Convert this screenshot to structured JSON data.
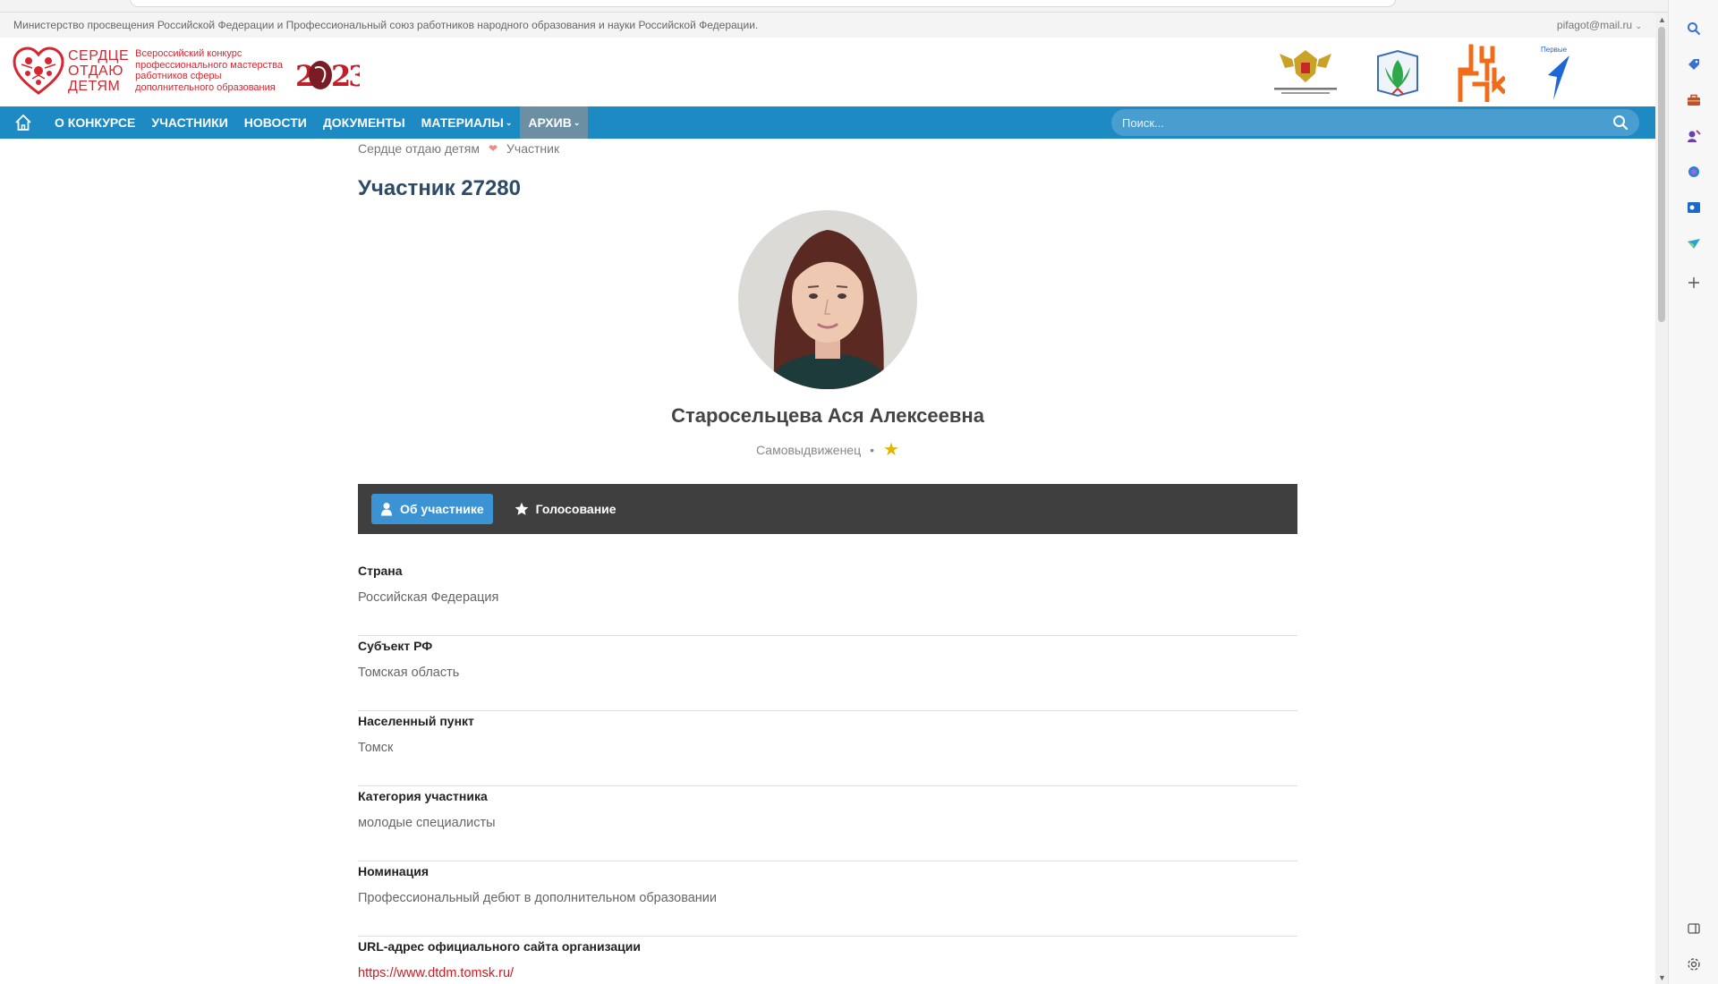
{
  "top_strip": {
    "ministry_text": "Министерство просвещения Российской Федерации и Профессиональный союз работников народного образования и науки Российской Федерации.",
    "user_email": "pifagot@mail.ru"
  },
  "header": {
    "logo_big_line1": "СЕРДЦЕ",
    "logo_big_line2": "ОТДАЮ",
    "logo_big_line3": "ДЕТЯМ",
    "logo_small_line1": "Всероссийский конкурс",
    "logo_small_line2": "профессионального мастерства",
    "logo_small_line3": "работников сферы",
    "logo_small_line4": "дополнительного образования",
    "year_logo": "2023",
    "partners": [
      "ministry-emblem",
      "profsoyuz-logo",
      "vtsk-logo",
      "pervye-logo"
    ],
    "pervye_label": "Первые"
  },
  "nav": {
    "items": [
      {
        "label": "О конкурсе"
      },
      {
        "label": "Участники"
      },
      {
        "label": "Новости"
      },
      {
        "label": "Документы"
      },
      {
        "label": "Материалы",
        "caret": "⌄"
      },
      {
        "label": "Архив",
        "caret": "⌄"
      }
    ],
    "search_placeholder": "Поиск..."
  },
  "breadcrumb": {
    "home": "Сердце отдаю детям",
    "current": "Участник"
  },
  "page_title": "Участник 27280",
  "profile": {
    "name": "Старосельцева Ася Алексеевна",
    "status": "Самовыдвиженец",
    "separator": "•"
  },
  "tabs": [
    {
      "label": "Об участнике",
      "icon": "user-icon"
    },
    {
      "label": "Голосование",
      "icon": "star-icon"
    }
  ],
  "fields": [
    {
      "label": "Страна",
      "value": "Российская Федерация"
    },
    {
      "label": "Субъект РФ",
      "value": "Томская область"
    },
    {
      "label": "Населенный пункт",
      "value": "Томск"
    },
    {
      "label": "Категория участника",
      "value": "молодые специалисты"
    },
    {
      "label": "Номинация",
      "value": "Профессиональный дебют в дополнительном образовании"
    },
    {
      "label": "URL-адрес официального сайта организации",
      "value": "https://www.dtdm.tomsk.ru/"
    }
  ],
  "colors": {
    "nav_blue": "#1d8ac4",
    "brand_red": "#d7262f",
    "tab_active": "#3b93d4",
    "title_blue": "#2e4a66"
  }
}
